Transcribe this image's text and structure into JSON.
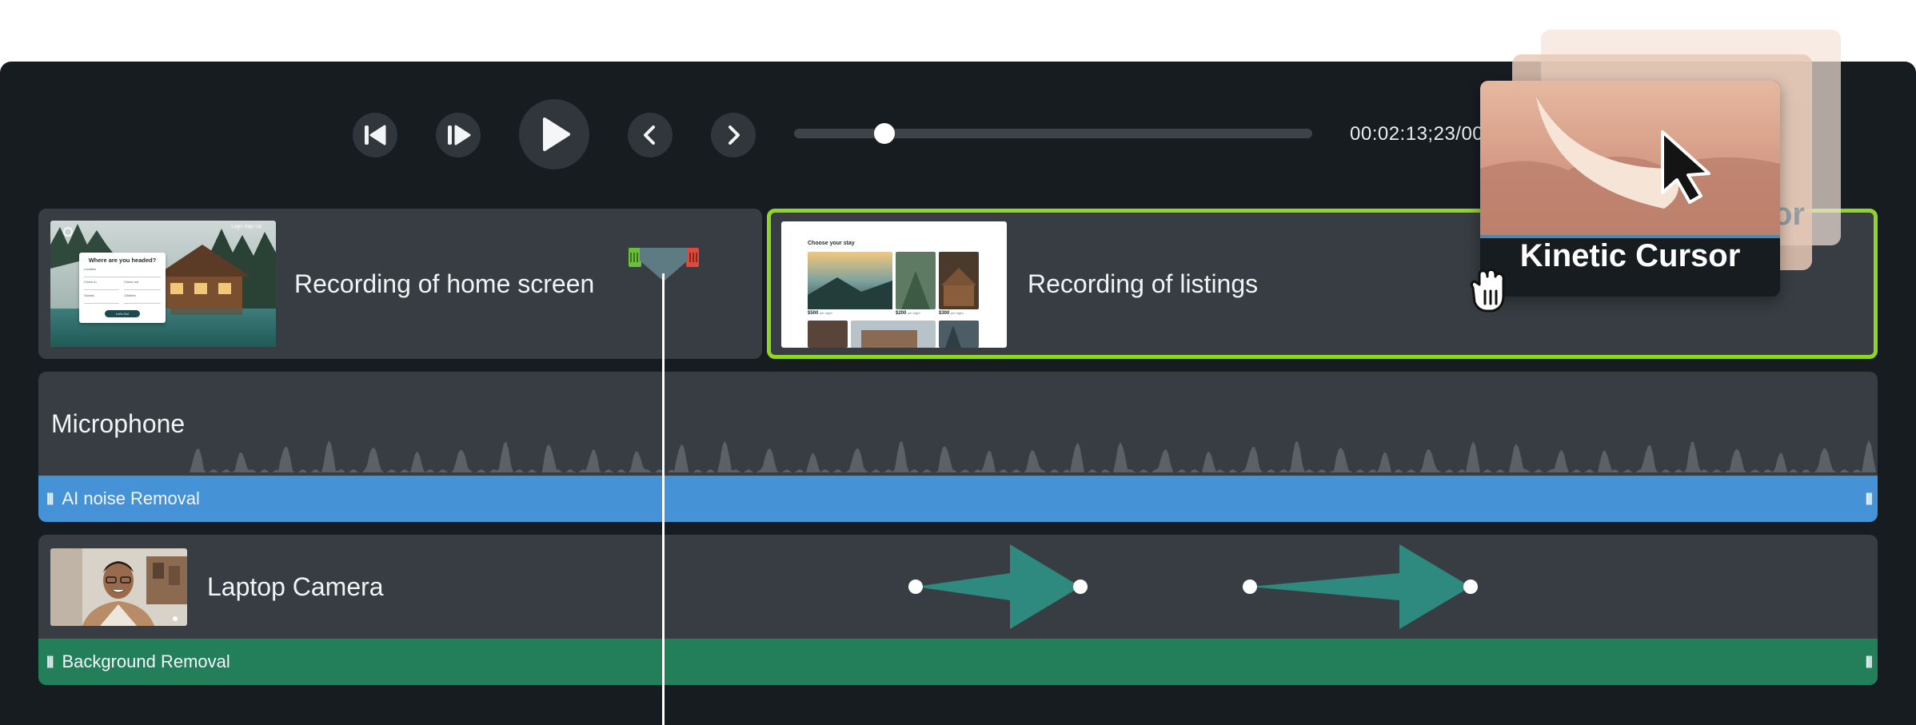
{
  "transport": {
    "timecode": "00:02:13;23/00",
    "playhead_progress": 0.175
  },
  "tracks": {
    "screen": {
      "clip1_label": "Recording of home screen",
      "clip2_label": "Recording of listings",
      "home_thumb": {
        "top_links": "Login  Sign Up",
        "heading": "Where are you headed?",
        "field1": "Location",
        "field2": "Check in",
        "field3": "Check out",
        "field4": "Guests",
        "field5": "Children",
        "button": "Let's Go!"
      },
      "listings_thumb": {
        "heading": "Choose your stay",
        "price1": "$500",
        "price2": "$200",
        "price3": "$300",
        "per_night": "per night"
      }
    },
    "audio": {
      "label": "Microphone",
      "effect_label": "AI noise Removal"
    },
    "camera": {
      "label": "Laptop Camera",
      "effect_label": "Background Removal"
    }
  },
  "kinetic_cursor": {
    "title": "Kinetic Cursor",
    "ghost_fragment": "or"
  },
  "colors": {
    "panel": "#171c21",
    "track": "#383d43",
    "selected_border": "#8fd624",
    "noise_removal": "#4692d6",
    "background_removal": "#237e5a",
    "animation": "#2e8a7e"
  },
  "icons": [
    "skip-back-icon",
    "frame-back-icon",
    "play-icon",
    "prev-icon",
    "next-icon",
    "grab-hand-icon",
    "cursor-icon"
  ]
}
